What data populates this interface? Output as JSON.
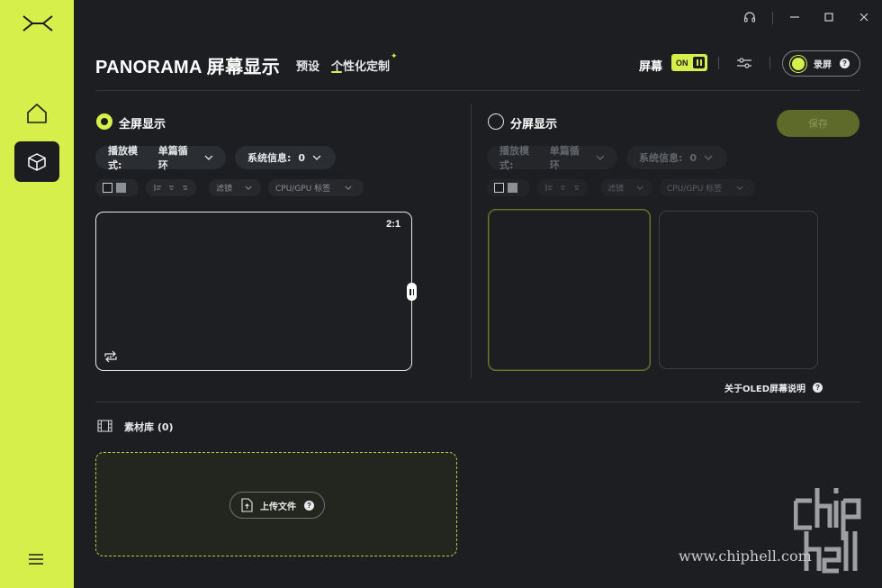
{
  "app": {
    "title": "PANORAMA 屏幕显示"
  },
  "tabs": [
    {
      "label": "预设",
      "active": false
    },
    {
      "label": "个性化定制",
      "active": true
    }
  ],
  "header": {
    "screen_label": "屏幕",
    "screen_toggle": "ON",
    "record_label": "录屏"
  },
  "fullscreen": {
    "title": "全屏显示",
    "selected": true,
    "play_mode_label": "播放模式:",
    "play_mode_value": "单篇循环",
    "sysinfo_label": "系统信息:",
    "sysinfo_value": "0",
    "filter_label": "滤镜",
    "tag_label": "CPU/GPU 标签",
    "ratio": "2:1"
  },
  "splitscreen": {
    "title": "分屏显示",
    "selected": false,
    "save_label": "保存",
    "play_mode_label": "播放模式:",
    "play_mode_value": "单篇循环",
    "sysinfo_label": "系统信息:",
    "sysinfo_value": "0",
    "filter_label": "滤镜",
    "tag_label": "CPU/GPU 标签",
    "oled_note": "关于OLED屏幕说明"
  },
  "library": {
    "label": "素材库 (0)",
    "upload_label": "上传文件"
  },
  "watermark": {
    "url": "www.chiphell.com"
  },
  "colors": {
    "accent": "#d6ef4a",
    "background": "#1c1e22",
    "sidebar": "#d6ef4a"
  }
}
